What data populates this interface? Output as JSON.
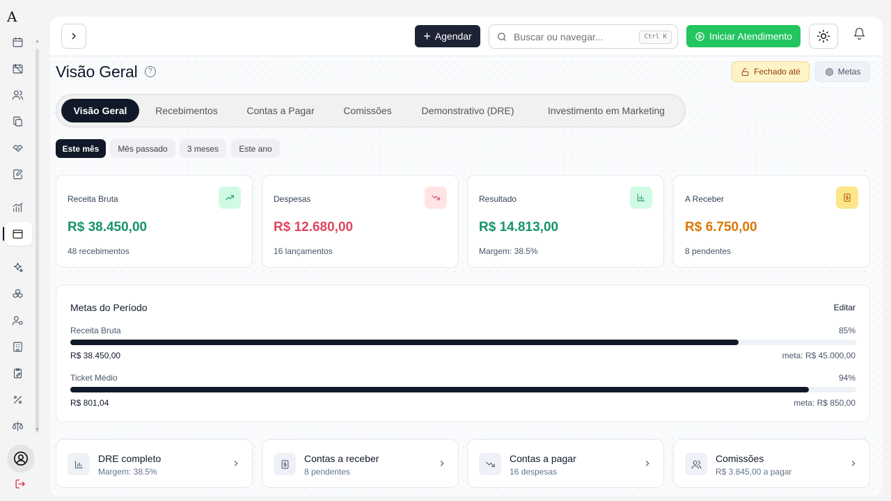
{
  "app": {
    "logo": "A"
  },
  "header": {
    "agendar_label": "Agendar",
    "search_placeholder": "Buscar ou navegar...",
    "search_shortcut": "Ctrl K",
    "iniciar_label": "Iniciar Atendimento"
  },
  "page": {
    "title": "Visão Geral",
    "fechado_label": "Fechado até",
    "metas_label": "Metas"
  },
  "tabs": [
    {
      "label": "Visão Geral",
      "active": true
    },
    {
      "label": "Recebimentos",
      "active": false
    },
    {
      "label": "Contas a Pagar",
      "active": false
    },
    {
      "label": "Comissões",
      "active": false
    },
    {
      "label": "Demonstrativo (DRE)",
      "active": false
    },
    {
      "label": "Investimento em Marketing",
      "active": false
    }
  ],
  "periods": [
    {
      "label": "Este mês",
      "active": true
    },
    {
      "label": "Mês passado",
      "active": false
    },
    {
      "label": "3 meses",
      "active": false
    },
    {
      "label": "Este ano",
      "active": false
    }
  ],
  "cards": [
    {
      "label": "Receita Bruta",
      "value": "R$ 38.450,00",
      "sub": "48 recebimentos",
      "color": "#15936b",
      "icon_bg": "#d1fae5",
      "icon": "trending-up-icon"
    },
    {
      "label": "Despesas",
      "value": "R$ 12.680,00",
      "sub": "16 lançamentos",
      "color": "#e0455e",
      "icon_bg": "#ffe4e6",
      "icon": "trending-down-icon"
    },
    {
      "label": "Resultado",
      "value": "R$ 14.813,00",
      "sub": "Margem: 38.5%",
      "color": "#15936b",
      "icon_bg": "#d1fae5",
      "icon": "bar-chart-icon"
    },
    {
      "label": "A Receber",
      "value": "R$ 6.750,00",
      "sub": "8 pendentes",
      "color": "#d97706",
      "icon_bg": "#fef3c7",
      "icon": "dollar-doc-icon"
    }
  ],
  "goals": {
    "title": "Metas do Período",
    "edit_label": "Editar",
    "items": [
      {
        "name": "Receita Bruta",
        "percent_label": "85%",
        "percent": 85,
        "current": "R$ 38.450,00",
        "target": "meta: R$ 45.000,00"
      },
      {
        "name": "Ticket Médio",
        "percent_label": "94%",
        "percent": 94,
        "current": "R$ 801,04",
        "target": "meta: R$ 850,00"
      }
    ]
  },
  "links": [
    {
      "title": "DRE completo",
      "sub": "Margem: 38.5%",
      "icon": "bar-chart-icon"
    },
    {
      "title": "Contas a receber",
      "sub": "8 pendentes",
      "icon": "dollar-doc-icon"
    },
    {
      "title": "Contas a pagar",
      "sub": "16 despesas",
      "icon": "trending-down-icon"
    },
    {
      "title": "Comissões",
      "sub": "R$ 3.845,00 a pagar",
      "icon": "users-icon"
    }
  ],
  "colors": {
    "accent_dark": "#111827",
    "green": "#22c55e",
    "amber_bg": "#fef3c7"
  }
}
